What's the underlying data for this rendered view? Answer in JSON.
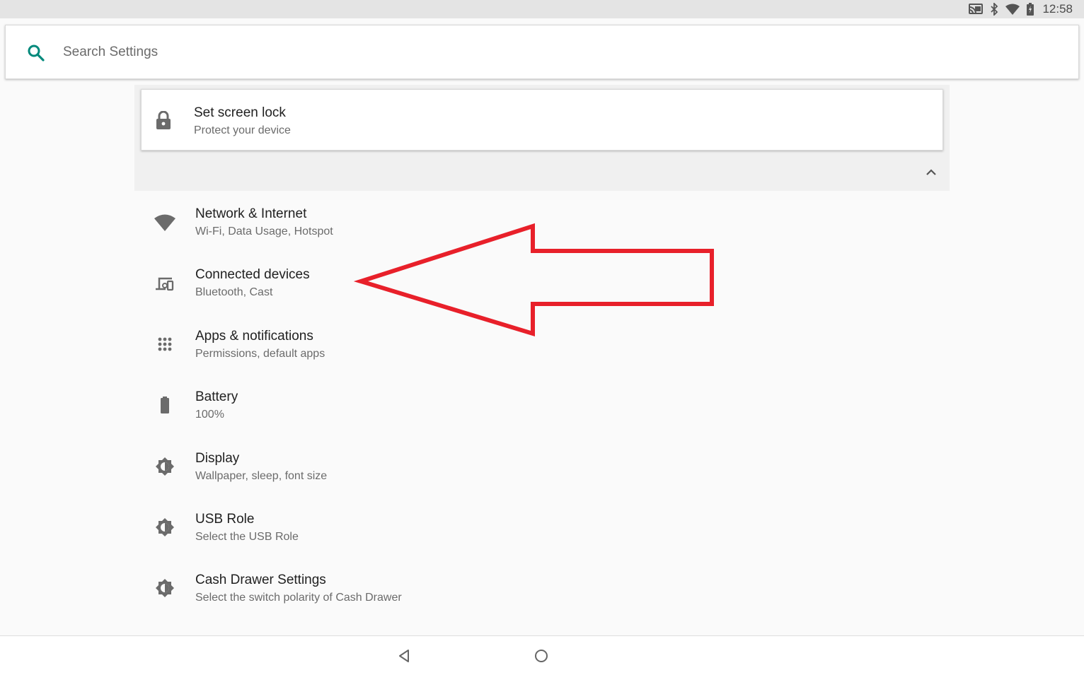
{
  "status_bar": {
    "time": "12:58",
    "icons": [
      "cast-icon",
      "bluetooth-icon",
      "wifi-icon",
      "battery-icon"
    ]
  },
  "search": {
    "placeholder": "Search Settings",
    "icon": "search-icon",
    "accent_color": "#00897b"
  },
  "suggestion": {
    "title": "Set screen lock",
    "subtitle": "Protect your device",
    "icon": "lock-icon",
    "collapse_icon": "chevron-up-icon"
  },
  "settings": {
    "items": [
      {
        "title": "Network & Internet",
        "subtitle": "Wi-Fi, Data Usage, Hotspot",
        "icon": "wifi-icon"
      },
      {
        "title": "Connected devices",
        "subtitle": "Bluetooth, Cast",
        "icon": "devices-icon"
      },
      {
        "title": "Apps & notifications",
        "subtitle": "Permissions, default apps",
        "icon": "apps-grid-icon"
      },
      {
        "title": "Battery",
        "subtitle": "100%",
        "icon": "battery-icon"
      },
      {
        "title": "Display",
        "subtitle": "Wallpaper, sleep, font size",
        "icon": "brightness-icon"
      },
      {
        "title": "USB Role",
        "subtitle": "Select the USB Role",
        "icon": "brightness-icon"
      },
      {
        "title": "Cash Drawer Settings",
        "subtitle": "Select the switch polarity of Cash Drawer",
        "icon": "brightness-icon"
      }
    ]
  },
  "annotation": {
    "type": "arrow",
    "color": "#e8202a",
    "points_to": "Connected devices"
  },
  "nav_bar": {
    "buttons": [
      "back-icon",
      "home-icon"
    ]
  }
}
